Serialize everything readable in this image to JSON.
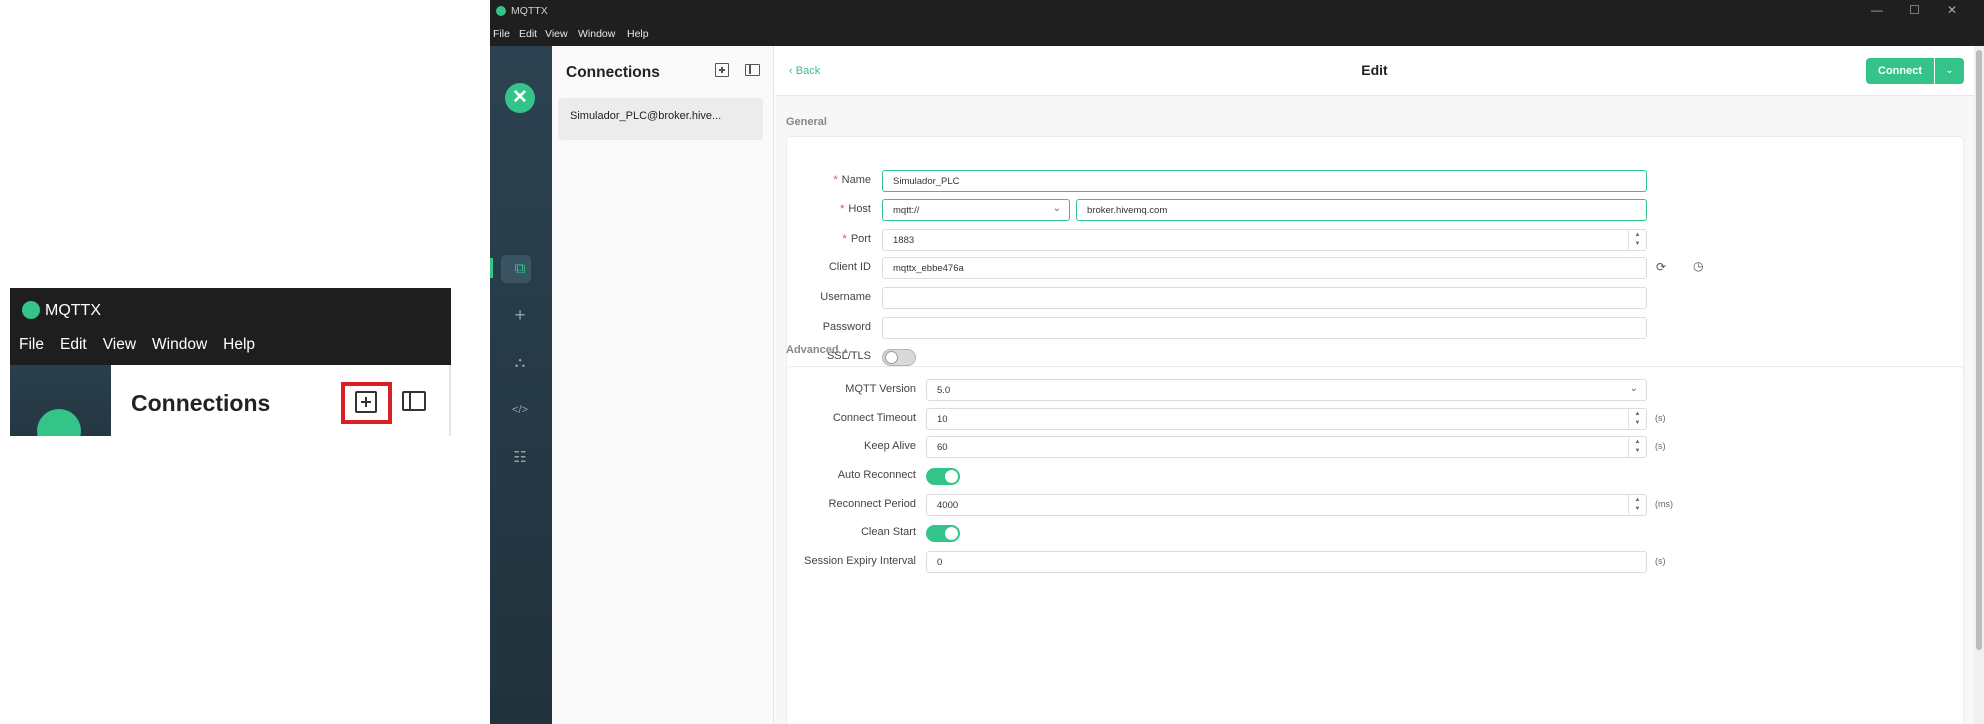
{
  "inset": {
    "app_title": "MQTTX",
    "menu": [
      "File",
      "Edit",
      "View",
      "Window",
      "Help"
    ],
    "connections_title": "Connections"
  },
  "window": {
    "app_title": "MQTTX",
    "controls": {
      "minimize": "—",
      "maximize": "☐",
      "close": "✕"
    },
    "menu": [
      "File",
      "Edit",
      "View",
      "Window",
      "Help"
    ]
  },
  "sidebar": {
    "logo": "✕",
    "icons": [
      "connections-icon",
      "plus-icon",
      "topology-icon",
      "code-icon",
      "log-icon"
    ],
    "glyphs": {
      "connections": "⧉",
      "add": "+",
      "topology": "⛬",
      "script": "</>",
      "log": "☷"
    }
  },
  "connections": {
    "title": "Connections",
    "items": [
      {
        "label": "Simulador_PLC@broker.hive..."
      }
    ]
  },
  "topbar": {
    "back_label": "Back",
    "title": "Edit",
    "connect_label": "Connect"
  },
  "general": {
    "title": "General",
    "name_label": "Name",
    "name_value": "Simulador_PLC",
    "host_label": "Host",
    "protocol_value": "mqtt://",
    "host_value": "broker.hivemq.com",
    "port_label": "Port",
    "port_value": "1883",
    "client_id_label": "Client ID",
    "client_id_value": "mqttx_ebbe476a",
    "username_label": "Username",
    "username_value": "",
    "password_label": "Password",
    "password_value": "",
    "ssl_label": "SSL/TLS",
    "ssl_on": false
  },
  "advanced": {
    "title": "Advanced",
    "mqtt_version_label": "MQTT Version",
    "mqtt_version_value": "5.0",
    "connect_timeout_label": "Connect Timeout",
    "connect_timeout_value": "10",
    "connect_timeout_unit": "(s)",
    "keep_alive_label": "Keep Alive",
    "keep_alive_value": "60",
    "keep_alive_unit": "(s)",
    "auto_reconnect_label": "Auto Reconnect",
    "auto_reconnect_on": true,
    "reconnect_period_label": "Reconnect Period",
    "reconnect_period_value": "4000",
    "reconnect_period_unit": "(ms)",
    "clean_start_label": "Clean Start",
    "clean_start_on": true,
    "session_expiry_label": "Session Expiry Interval",
    "session_expiry_value": "0",
    "session_expiry_unit": "(s)"
  },
  "colors": {
    "accent": "#34c388",
    "highlight": "#d92026",
    "titlebar": "#1f1f1f"
  }
}
